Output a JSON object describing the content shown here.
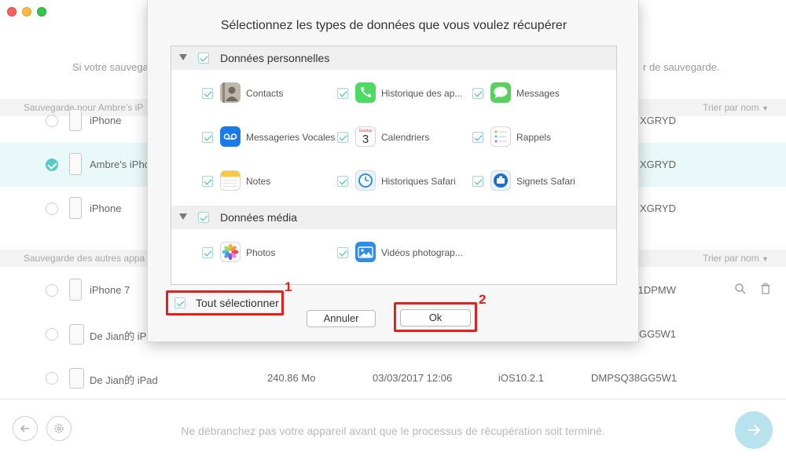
{
  "background": {
    "info_left": "Si votre sauvega",
    "info_right": "r de sauvegarde.",
    "section1": {
      "label": "Sauvegarde pour Ambre's iP",
      "sort": "Trier par nom"
    },
    "section2": {
      "label": "Sauvegarde des autres appa",
      "sort": "Trier par nom"
    },
    "rows1": [
      {
        "name": "iPhone",
        "serial": "XGRYD",
        "selected": false
      },
      {
        "name": "Ambre's iPho",
        "serial": "XGRYD",
        "selected": true
      },
      {
        "name": "iPhone",
        "serial": "XGRYD",
        "selected": false
      }
    ],
    "rows2": [
      {
        "name": "iPhone 7",
        "serial": "1DPMW"
      },
      {
        "name": "De Jian的 iP",
        "serial": "GG5W1"
      },
      {
        "name": "De Jian的 iPad",
        "size": "240.86 Mo",
        "date": "03/03/2017 12:06",
        "ios": "iOS10.2.1",
        "serial": "DMPSQ38GG5W1"
      }
    ],
    "bottom_message": "Ne débranchez pas votre appareil avant que le processus de récupération soit terminé."
  },
  "modal": {
    "title": "Sélectionnez les types de données que vous voulez récupérer",
    "categories": [
      {
        "label": "Données personnelles",
        "items": [
          {
            "label": "Contacts",
            "icon": "contacts-icon"
          },
          {
            "label": "Historique des ap...",
            "icon": "phone-icon"
          },
          {
            "label": "Messages",
            "icon": "messages-icon"
          },
          {
            "label": "Messageries Vocales",
            "icon": "voicemail-icon"
          },
          {
            "label": "Calendriers",
            "icon": "calendar-icon",
            "calendar_day": "Sunday",
            "calendar_date": "3"
          },
          {
            "label": "Rappels",
            "icon": "reminders-icon"
          },
          {
            "label": "Notes",
            "icon": "notes-icon"
          },
          {
            "label": "Historiques Safari",
            "icon": "safari-history-icon"
          },
          {
            "label": "Signets Safari",
            "icon": "safari-bookmarks-icon"
          }
        ]
      },
      {
        "label": "Données média",
        "items": [
          {
            "label": "Photos",
            "icon": "photos-icon"
          },
          {
            "label": "Vidéos photograp...",
            "icon": "videos-icon"
          }
        ]
      }
    ],
    "select_all_label": "Tout sélectionner",
    "cancel_label": "Annuler",
    "ok_label": "Ok",
    "annotation_1": "1",
    "annotation_2": "2"
  }
}
